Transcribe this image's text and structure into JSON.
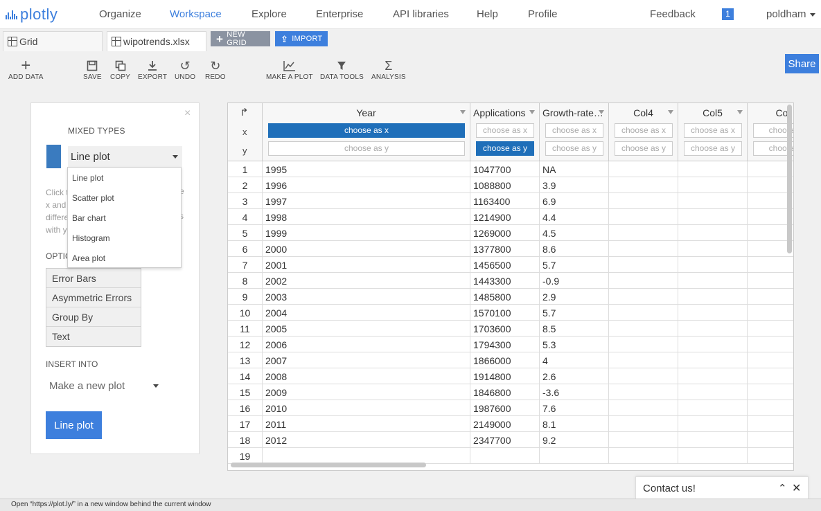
{
  "nav": {
    "logo": "plotly",
    "links": [
      "Organize",
      "Workspace",
      "Explore",
      "Enterprise",
      "API libraries",
      "Help",
      "Profile"
    ],
    "active": "Workspace",
    "feedback": "Feedback",
    "notification_count": "1",
    "user": "poldham"
  },
  "tabs": {
    "grid": "Grid",
    "file": "wipotrends.xlsx",
    "new_grid": "NEW GRID",
    "import": "IMPORT"
  },
  "toolbar": {
    "add_data": "ADD DATA",
    "save": "SAVE",
    "copy": "COPY",
    "export": "EXPORT",
    "undo": "UNDO",
    "redo": "REDO",
    "make_plot": "MAKE A PLOT",
    "data_tools": "DATA TOOLS",
    "analysis": "ANALYSIS",
    "share": "Share"
  },
  "panel": {
    "close": "×",
    "mixed_types": "MIXED TYPES",
    "selected_type": "Line plot",
    "help_left": [
      "Click t",
      "x and",
      "differe",
      "with y"
    ],
    "help_right": [
      "e",
      "s"
    ],
    "options_title": "OPTIC",
    "options": [
      "Error Bars",
      "Asymmetric Errors",
      "Group By",
      "Text"
    ],
    "insert_title": "INSERT INTO",
    "insert_value": "Make a new plot",
    "create_button": "Line plot",
    "series_color": "#3a7bbf"
  },
  "plot_type_dropdown": [
    "Line plot",
    "Scatter plot",
    "Bar chart",
    "Histogram",
    "Area plot"
  ],
  "grid": {
    "corner_arrow": "↱",
    "x_label": "x",
    "y_label": "y",
    "columns": [
      {
        "name": "Year",
        "x": "choose as x",
        "y": "choose as y",
        "x_selected": true,
        "y_selected": false
      },
      {
        "name": "Applications",
        "x": "choose as x",
        "y": "choose as y",
        "x_selected": false,
        "y_selected": true
      },
      {
        "name": "Growth-rate…",
        "x": "choose as x",
        "y": "choose as y",
        "x_selected": false,
        "y_selected": false
      },
      {
        "name": "Col4",
        "x": "choose as x",
        "y": "choose as y",
        "x_selected": false,
        "y_selected": false
      },
      {
        "name": "Col5",
        "x": "choose as x",
        "y": "choose as y",
        "x_selected": false,
        "y_selected": false
      },
      {
        "name": "Co",
        "x": "choose",
        "y": "choose",
        "x_selected": false,
        "y_selected": false
      }
    ],
    "rows": [
      [
        "1",
        "1995",
        "1047700",
        "NA"
      ],
      [
        "2",
        "1996",
        "1088800",
        "3.9"
      ],
      [
        "3",
        "1997",
        "1163400",
        "6.9"
      ],
      [
        "4",
        "1998",
        "1214900",
        "4.4"
      ],
      [
        "5",
        "1999",
        "1269000",
        "4.5"
      ],
      [
        "6",
        "2000",
        "1377800",
        "8.6"
      ],
      [
        "7",
        "2001",
        "1456500",
        "5.7"
      ],
      [
        "8",
        "2002",
        "1443300",
        "-0.9"
      ],
      [
        "9",
        "2003",
        "1485800",
        "2.9"
      ],
      [
        "10",
        "2004",
        "1570100",
        "5.7"
      ],
      [
        "11",
        "2005",
        "1703600",
        "8.5"
      ],
      [
        "12",
        "2006",
        "1794300",
        "5.3"
      ],
      [
        "13",
        "2007",
        "1866000",
        "4"
      ],
      [
        "14",
        "2008",
        "1914800",
        "2.6"
      ],
      [
        "15",
        "2009",
        "1846800",
        "-3.6"
      ],
      [
        "16",
        "2010",
        "1987600",
        "7.6"
      ],
      [
        "17",
        "2011",
        "2149000",
        "8.1"
      ],
      [
        "18",
        "2012",
        "2347700",
        "9.2"
      ],
      [
        "19",
        "",
        "",
        ""
      ]
    ]
  },
  "contact": {
    "label": "Contact us!",
    "chevron": "⌃",
    "close": "✕"
  },
  "status": "Open “https://plot.ly/” in a new window behind the current window",
  "colors": {
    "accent": "#3d7fdd",
    "selected_chooser": "#1f6fb9"
  }
}
